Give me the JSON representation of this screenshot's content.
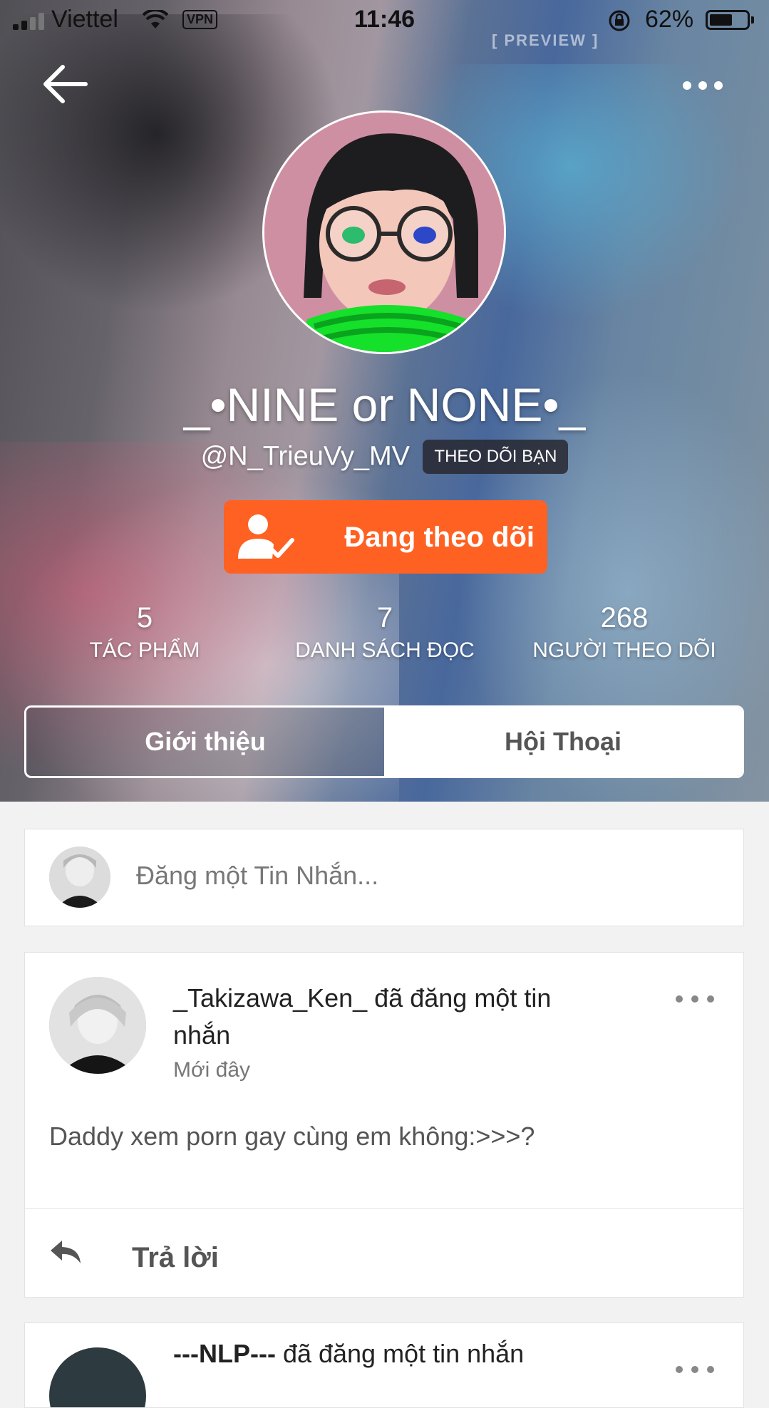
{
  "status_bar": {
    "carrier": "Viettel",
    "vpn": "VPN",
    "time": "11:46",
    "battery_percent": "62%",
    "battery_level": 0.62
  },
  "cover": {
    "preview_tag": "[ PREVIEW ]"
  },
  "profile": {
    "display_name": "_•NINE or NONE•_",
    "handle": "@N_TrieuVy_MV",
    "follows_you_badge": "THEO DÕI BẠN",
    "follow_button_label": "Đang theo dõi"
  },
  "stats": [
    {
      "value": "5",
      "label": "TÁC PHẨM"
    },
    {
      "value": "7",
      "label": "DANH SÁCH ĐỌC"
    },
    {
      "value": "268",
      "label": "NGƯỜI THEO DÕI"
    }
  ],
  "tabs": {
    "intro": "Giới thiệu",
    "conversation": "Hội Thoại"
  },
  "compose": {
    "placeholder": "Đăng một Tin Nhắn..."
  },
  "posts": [
    {
      "headline": "_Takizawa_Ken_ đã đăng một tin nhắn",
      "time": "Mới đây",
      "message": "Daddy xem porn gay cùng em không:>>>?",
      "reply_label": "Trả lời"
    },
    {
      "author": "---NLP---",
      "headline_suffix": " đã đăng một tin nhắn"
    }
  ],
  "colors": {
    "accent": "#ff6122",
    "page_background": "#f2f2f2"
  }
}
